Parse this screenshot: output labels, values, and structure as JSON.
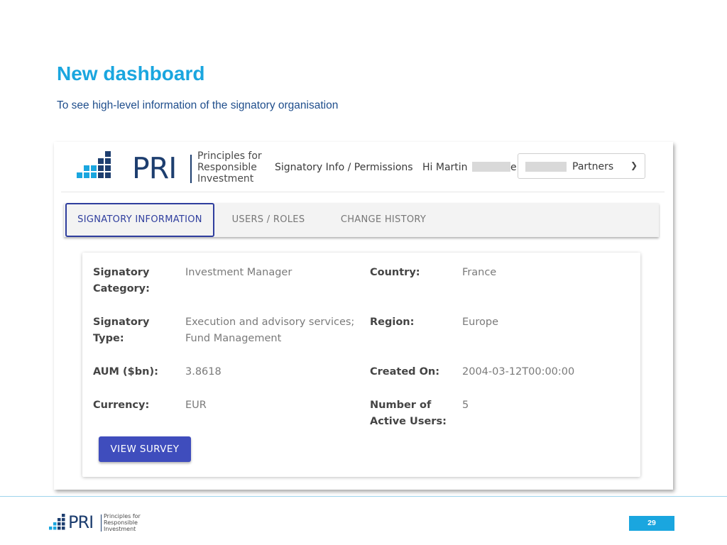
{
  "slide": {
    "title": "New dashboard",
    "subtitle": "To see high-level information of the signatory organisation",
    "page_number": "29"
  },
  "brand": {
    "logo_text": "PRI",
    "tagline_1": "Principles for",
    "tagline_2": "Responsible",
    "tagline_3": "Investment",
    "primary_color": "#1d3e6f",
    "accent_color": "#1aa6df"
  },
  "header": {
    "nav_link": "Signatory Info / Permissions",
    "greeting_prefix": "Hi Martin",
    "greeting_suffix": "e",
    "org_select_value": "Partners",
    "org_select_caret_icon": "chevron-down-icon"
  },
  "tabs": [
    {
      "label": "SIGNATORY INFORMATION",
      "active": true
    },
    {
      "label": "USERS / ROLES",
      "active": false
    },
    {
      "label": "CHANGE HISTORY",
      "active": false
    }
  ],
  "info": {
    "category_label_1": "Signatory",
    "category_label_2": "Category:",
    "category_value": "Investment Manager",
    "type_label_1": "Signatory",
    "type_label_2": "Type:",
    "type_value_1": "Execution and advisory services;",
    "type_value_2": "Fund Management",
    "aum_label": "AUM ($bn):",
    "aum_value": "3.8618",
    "currency_label": "Currency:",
    "currency_value": "EUR",
    "country_label": "Country:",
    "country_value": "France",
    "region_label": "Region:",
    "region_value": "Europe",
    "created_label": "Created On:",
    "created_value": "2004-03-12T00:00:00",
    "users_label_1": "Number of",
    "users_label_2": "Active Users:",
    "users_value": "5"
  },
  "actions": {
    "view_survey": "VIEW SURVEY",
    "button_color": "#3f4dbd"
  }
}
